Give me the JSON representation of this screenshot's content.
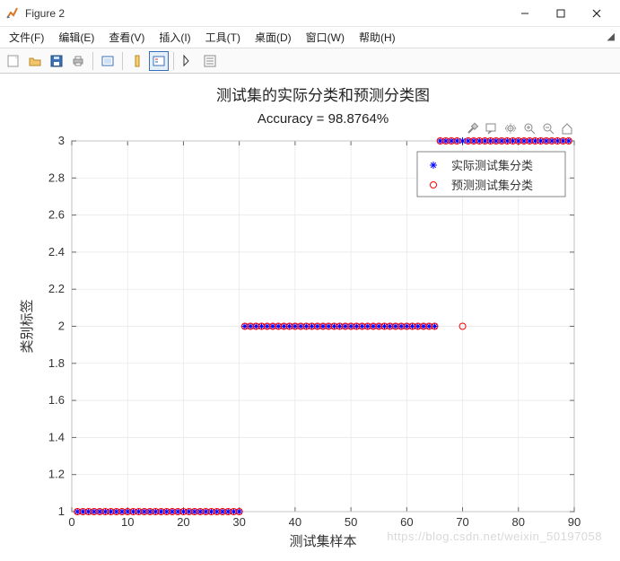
{
  "window": {
    "title": "Figure 2"
  },
  "menu": {
    "file": "文件(F)",
    "edit": "编辑(E)",
    "view": "查看(V)",
    "insert": "插入(I)",
    "tools": "工具(T)",
    "desktop": "桌面(D)",
    "window": "窗口(W)",
    "help": "帮助(H)"
  },
  "chart_data": {
    "type": "scatter",
    "title": "测试集的实际分类和预测分类图",
    "subtitle": "Accuracy = 98.8764%",
    "xlabel": "测试集样本",
    "ylabel": "类别标签",
    "xlim": [
      0,
      90
    ],
    "ylim": [
      1,
      3
    ],
    "xticks": [
      0,
      10,
      20,
      30,
      40,
      50,
      60,
      70,
      80,
      90
    ],
    "yticks": [
      1,
      1.2,
      1.4,
      1.6,
      1.8,
      2,
      2.2,
      2.4,
      2.6,
      2.8,
      3
    ],
    "legend": {
      "position": "northeast_inside",
      "items": [
        {
          "name": "实际测试集分类",
          "marker": "asterisk",
          "color": "#0000ff"
        },
        {
          "name": "预测测试集分类",
          "marker": "circle",
          "color": "#ff0000"
        }
      ]
    },
    "series": [
      {
        "name": "实际测试集分类",
        "marker": "asterisk",
        "color": "#0000ff",
        "x": [
          1,
          2,
          3,
          4,
          5,
          6,
          7,
          8,
          9,
          10,
          11,
          12,
          13,
          14,
          15,
          16,
          17,
          18,
          19,
          20,
          21,
          22,
          23,
          24,
          25,
          26,
          27,
          28,
          29,
          30,
          31,
          32,
          33,
          34,
          35,
          36,
          37,
          38,
          39,
          40,
          41,
          42,
          43,
          44,
          45,
          46,
          47,
          48,
          49,
          50,
          51,
          52,
          53,
          54,
          55,
          56,
          57,
          58,
          59,
          60,
          61,
          62,
          63,
          64,
          65,
          66,
          67,
          68,
          69,
          70,
          71,
          72,
          73,
          74,
          75,
          76,
          77,
          78,
          79,
          80,
          81,
          82,
          83,
          84,
          85,
          86,
          87,
          88,
          89
        ],
        "y": [
          1,
          1,
          1,
          1,
          1,
          1,
          1,
          1,
          1,
          1,
          1,
          1,
          1,
          1,
          1,
          1,
          1,
          1,
          1,
          1,
          1,
          1,
          1,
          1,
          1,
          1,
          1,
          1,
          1,
          1,
          2,
          2,
          2,
          2,
          2,
          2,
          2,
          2,
          2,
          2,
          2,
          2,
          2,
          2,
          2,
          2,
          2,
          2,
          2,
          2,
          2,
          2,
          2,
          2,
          2,
          2,
          2,
          2,
          2,
          2,
          2,
          2,
          2,
          2,
          2,
          3,
          3,
          3,
          3,
          3,
          3,
          3,
          3,
          3,
          3,
          3,
          3,
          3,
          3,
          3,
          3,
          3,
          3,
          3,
          3,
          3,
          3,
          3,
          3
        ]
      },
      {
        "name": "预测测试集分类",
        "marker": "circle",
        "color": "#ff0000",
        "x": [
          1,
          2,
          3,
          4,
          5,
          6,
          7,
          8,
          9,
          10,
          11,
          12,
          13,
          14,
          15,
          16,
          17,
          18,
          19,
          20,
          21,
          22,
          23,
          24,
          25,
          26,
          27,
          28,
          29,
          30,
          31,
          32,
          33,
          34,
          35,
          36,
          37,
          38,
          39,
          40,
          41,
          42,
          43,
          44,
          45,
          46,
          47,
          48,
          49,
          50,
          51,
          52,
          53,
          54,
          55,
          56,
          57,
          58,
          59,
          60,
          61,
          62,
          63,
          64,
          65,
          66,
          67,
          68,
          69,
          70,
          71,
          72,
          73,
          74,
          75,
          76,
          77,
          78,
          79,
          80,
          81,
          82,
          83,
          84,
          85,
          86,
          87,
          88,
          89
        ],
        "y": [
          1,
          1,
          1,
          1,
          1,
          1,
          1,
          1,
          1,
          1,
          1,
          1,
          1,
          1,
          1,
          1,
          1,
          1,
          1,
          1,
          1,
          1,
          1,
          1,
          1,
          1,
          1,
          1,
          1,
          1,
          2,
          2,
          2,
          2,
          2,
          2,
          2,
          2,
          2,
          2,
          2,
          2,
          2,
          2,
          2,
          2,
          2,
          2,
          2,
          2,
          2,
          2,
          2,
          2,
          2,
          2,
          2,
          2,
          2,
          2,
          2,
          2,
          2,
          2,
          2,
          3,
          3,
          3,
          3,
          2,
          3,
          3,
          3,
          3,
          3,
          3,
          3,
          3,
          3,
          3,
          3,
          3,
          3,
          3,
          3,
          3,
          3,
          3,
          3
        ]
      }
    ]
  },
  "watermark": "https://blog.csdn.net/weixin_50197058"
}
